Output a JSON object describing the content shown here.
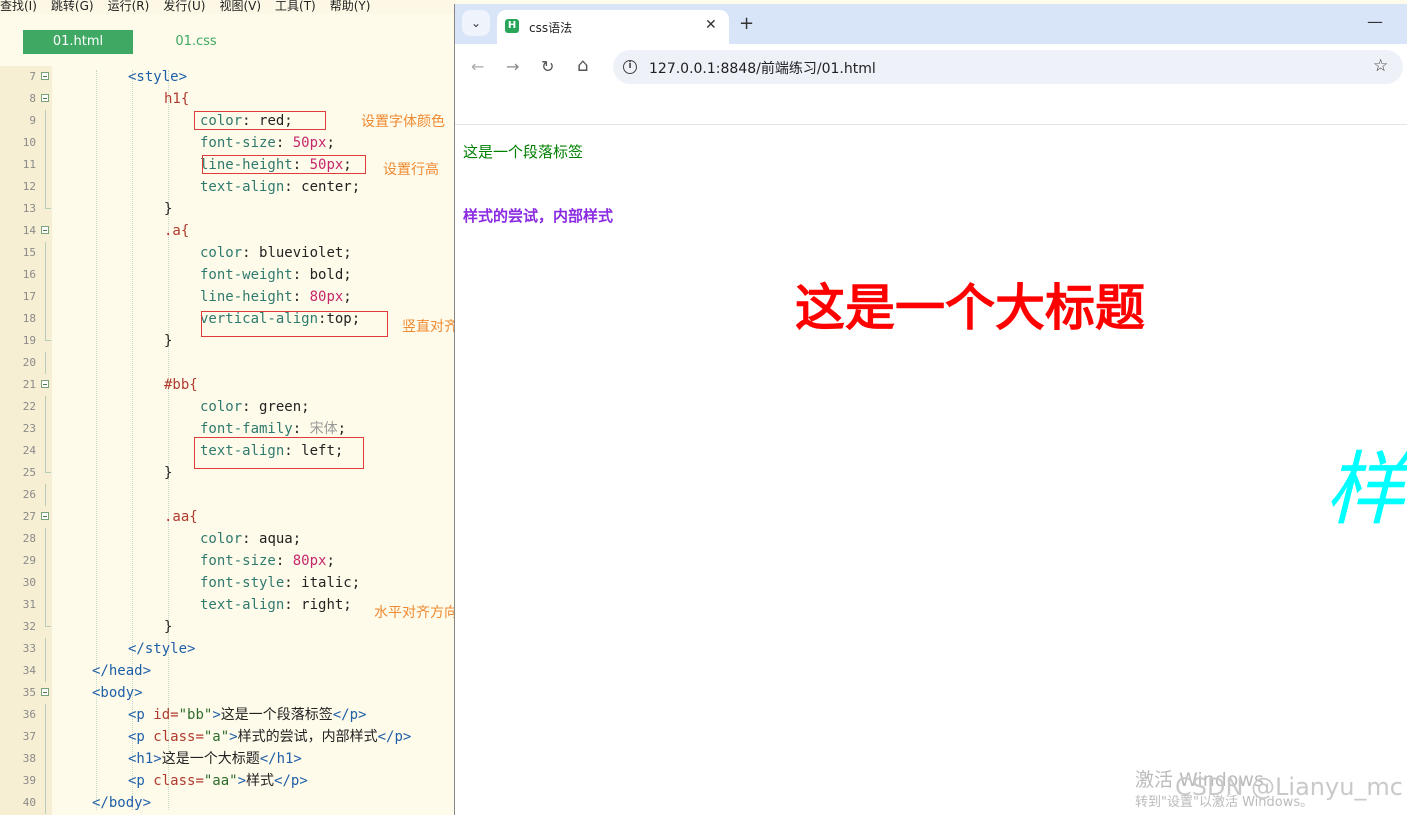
{
  "menubar": [
    "查找(I)",
    "跳转(G)",
    "运行(R)",
    "发行(U)",
    "视图(V)",
    "工具(T)",
    "帮助(Y)"
  ],
  "editor_tabs": [
    "01.html",
    "01.css"
  ],
  "annotations": {
    "font_color": "设置字体颜色",
    "line_height": "设置行高",
    "vertical_align": "竖直对齐方向",
    "horizontal_align": "水平对齐方向"
  },
  "code_lines": [
    {
      "n": "7",
      "fold": "open"
    },
    {
      "n": "8",
      "fold": "open"
    },
    {
      "n": "9"
    },
    {
      "n": "10"
    },
    {
      "n": "11"
    },
    {
      "n": "12"
    },
    {
      "n": "13",
      "fold": "end"
    },
    {
      "n": "14",
      "fold": "open"
    },
    {
      "n": "15"
    },
    {
      "n": "16"
    },
    {
      "n": "17"
    },
    {
      "n": "18"
    },
    {
      "n": "19",
      "fold": "end"
    },
    {
      "n": "20"
    },
    {
      "n": "21",
      "fold": "open"
    },
    {
      "n": "22"
    },
    {
      "n": "23"
    },
    {
      "n": "24"
    },
    {
      "n": "25",
      "fold": "end"
    },
    {
      "n": "26"
    },
    {
      "n": "27",
      "fold": "open"
    },
    {
      "n": "28"
    },
    {
      "n": "29"
    },
    {
      "n": "30"
    },
    {
      "n": "31"
    },
    {
      "n": "32",
      "fold": "end"
    },
    {
      "n": "33"
    },
    {
      "n": "34"
    },
    {
      "n": "35",
      "fold": "open"
    },
    {
      "n": "36"
    },
    {
      "n": "37"
    },
    {
      "n": "38"
    },
    {
      "n": "39"
    },
    {
      "n": "40"
    }
  ],
  "code_text": {
    "l7": "<style>",
    "l8": "h1{",
    "l9a": "color",
    "l9b": ": red;",
    "l10a": "font-size",
    "l10b": ": ",
    "l10c": "50",
    "l10d": "px",
    "l10e": ";",
    "l11a": "line-height",
    "l11b": ": ",
    "l11c": "50",
    "l11d": "px",
    "l11e": ";",
    "l12a": "text-align",
    "l12b": ": center;",
    "l13": "}",
    "l14": ".a{",
    "l15a": "color",
    "l15b": ": blueviolet;",
    "l16a": "font-weight",
    "l16b": ": bold;",
    "l17a": "line-height",
    "l17b": ": ",
    "l17c": "80",
    "l17d": "px",
    "l17e": ";",
    "l18a": "vertical-align",
    "l18b": ":top;",
    "l19": "}",
    "l21": "#bb{",
    "l22a": "color",
    "l22b": ": green;",
    "l23a": "font-family",
    "l23b": ": ",
    "l23c": "宋体",
    "l23d": ";",
    "l24a": "text-align",
    "l24b": ": left;",
    "l25": "}",
    "l27": ".aa{",
    "l28a": "color",
    "l28b": ": aqua;",
    "l29a": "font-size",
    "l29b": ": ",
    "l29c": "80",
    "l29d": "px",
    "l29e": ";",
    "l30a": "font-style",
    "l30b": ": italic;",
    "l31a": "text-align",
    "l31b": ": right;",
    "l32": "}",
    "l33": "</style>",
    "l34": "</head>",
    "l35": "<body>",
    "l36a": "<p ",
    "l36b": "id=",
    "l36c": "\"bb\"",
    "l36d": ">",
    "l36e": "这是一个段落标签",
    "l36f": "</p>",
    "l37a": "<p ",
    "l37b": "class=",
    "l37c": "\"a\"",
    "l37d": ">",
    "l37e": "样式的尝试，内部样式",
    "l37f": "</p>",
    "l38a": "<h1>",
    "l38b": "这是一个大标题",
    "l38c": "</h1>",
    "l39a": "<p ",
    "l39b": "class=",
    "l39c": "\"aa\"",
    "l39d": ">",
    "l39e": "样式",
    "l39f": "</p>",
    "l40": "</body>"
  },
  "browser": {
    "tab_title": "css语法",
    "favicon_letter": "H",
    "url": "127.0.0.1:8848/前端练习/01.html",
    "icons": [
      "tab-search-icon",
      "close-icon",
      "new-tab-icon",
      "minimize-icon",
      "back-icon",
      "forward-icon",
      "reload-icon",
      "home-icon",
      "info-icon",
      "star-icon"
    ],
    "glyphs": {
      "dropdown": "⌄",
      "close": "✕",
      "plus": "+",
      "minimize": "—",
      "back": "←",
      "forward": "→",
      "reload": "↻",
      "home": "⌂",
      "info": "i",
      "star": "☆"
    }
  },
  "page": {
    "p_bb": "这是一个段落标签",
    "p_a": "样式的尝试，内部样式",
    "h1": "这是一个大标题",
    "p_aa": "样式"
  },
  "watermark": {
    "line1": "激活 Windows",
    "line2": "转到\"设置\"以激活 Windows。",
    "csdn": "CSDN @Lianyu_mc"
  },
  "colors": {
    "editor_bg": "#fffbea",
    "tab_active": "#3fa863",
    "annotation": "#ee8a32",
    "box": "#e03c3c",
    "green": "#008000",
    "blueviolet": "#8a2be2",
    "red": "#ff0000",
    "aqua": "#00ffff"
  }
}
